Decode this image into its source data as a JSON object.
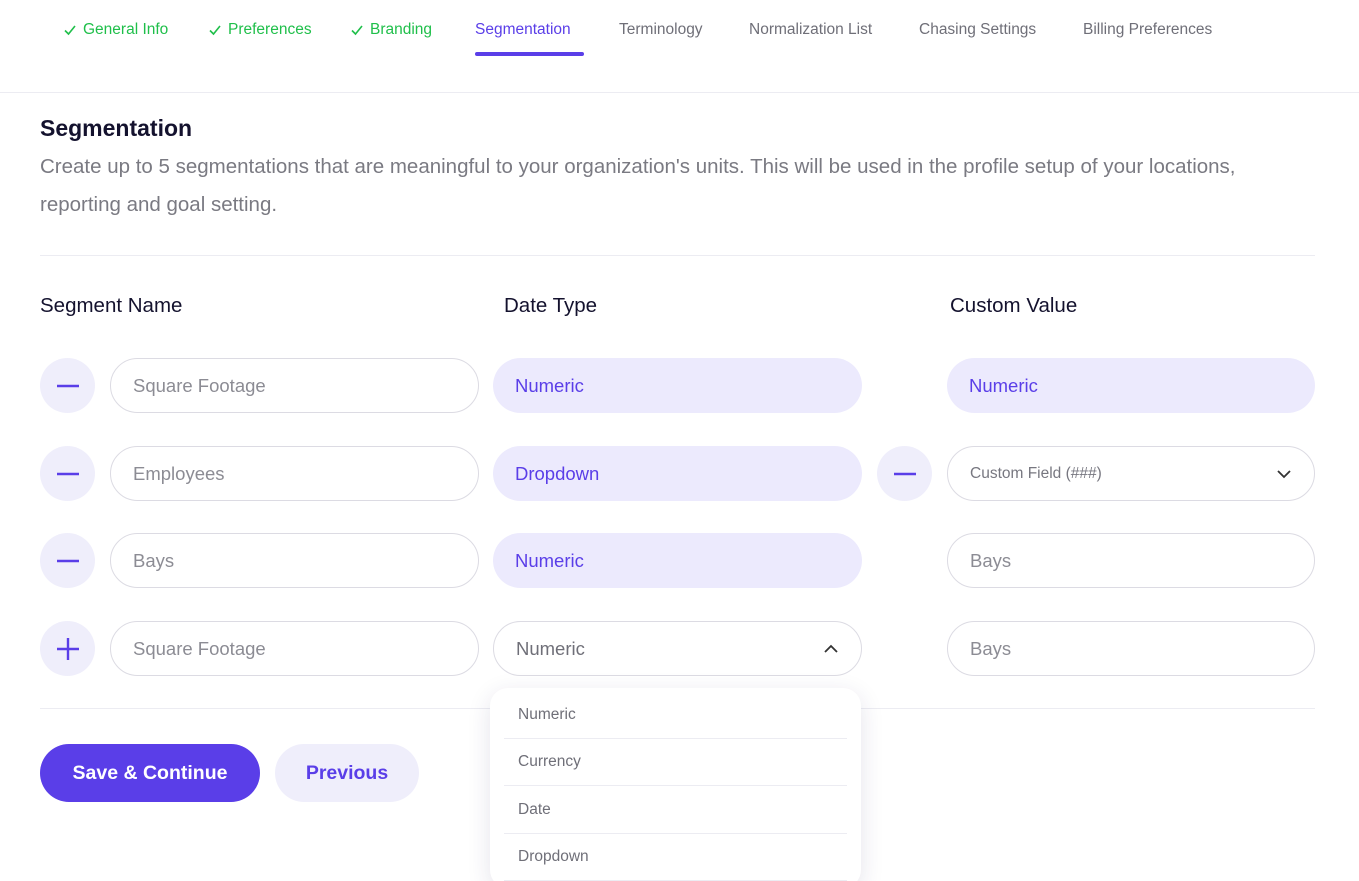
{
  "tabs": [
    {
      "label": "General Info",
      "state": "done"
    },
    {
      "label": "Preferences",
      "state": "done"
    },
    {
      "label": "Branding",
      "state": "done"
    },
    {
      "label": "Segmentation",
      "state": "active"
    },
    {
      "label": "Terminology",
      "state": "default"
    },
    {
      "label": "Normalization List",
      "state": "default"
    },
    {
      "label": "Chasing Settings",
      "state": "default"
    },
    {
      "label": "Billing Preferences",
      "state": "default"
    }
  ],
  "section": {
    "title": "Segmentation",
    "description": "Create up to 5 segmentations that are meaningful to your organization's units. This will be used in the profile setup of your locations, reporting and goal setting."
  },
  "columns": {
    "segment_name": "Segment Name",
    "data_type": "Date Type",
    "custom_value": "Custom Value"
  },
  "rows": [
    {
      "action": "remove",
      "name_placeholder": "Square Footage",
      "type": "Numeric",
      "custom": "Numeric"
    },
    {
      "action": "remove",
      "name_placeholder": "Employees",
      "type": "Dropdown",
      "custom": "Custom Field (###)"
    },
    {
      "action": "remove",
      "name_placeholder": "Bays",
      "type": "Numeric",
      "custom": "Bays"
    },
    {
      "action": "add",
      "name_placeholder": "Square Footage",
      "type": "Numeric",
      "custom": "Bays"
    }
  ],
  "type_options": [
    "Numeric",
    "Currency",
    "Date",
    "Dropdown"
  ],
  "buttons": {
    "save": "Save & Continue",
    "previous": "Previous"
  },
  "colors": {
    "accent": "#5a3ee8",
    "accent_light": "#eceafd",
    "success": "#1fbf4a",
    "muted": "#6f6f78"
  }
}
